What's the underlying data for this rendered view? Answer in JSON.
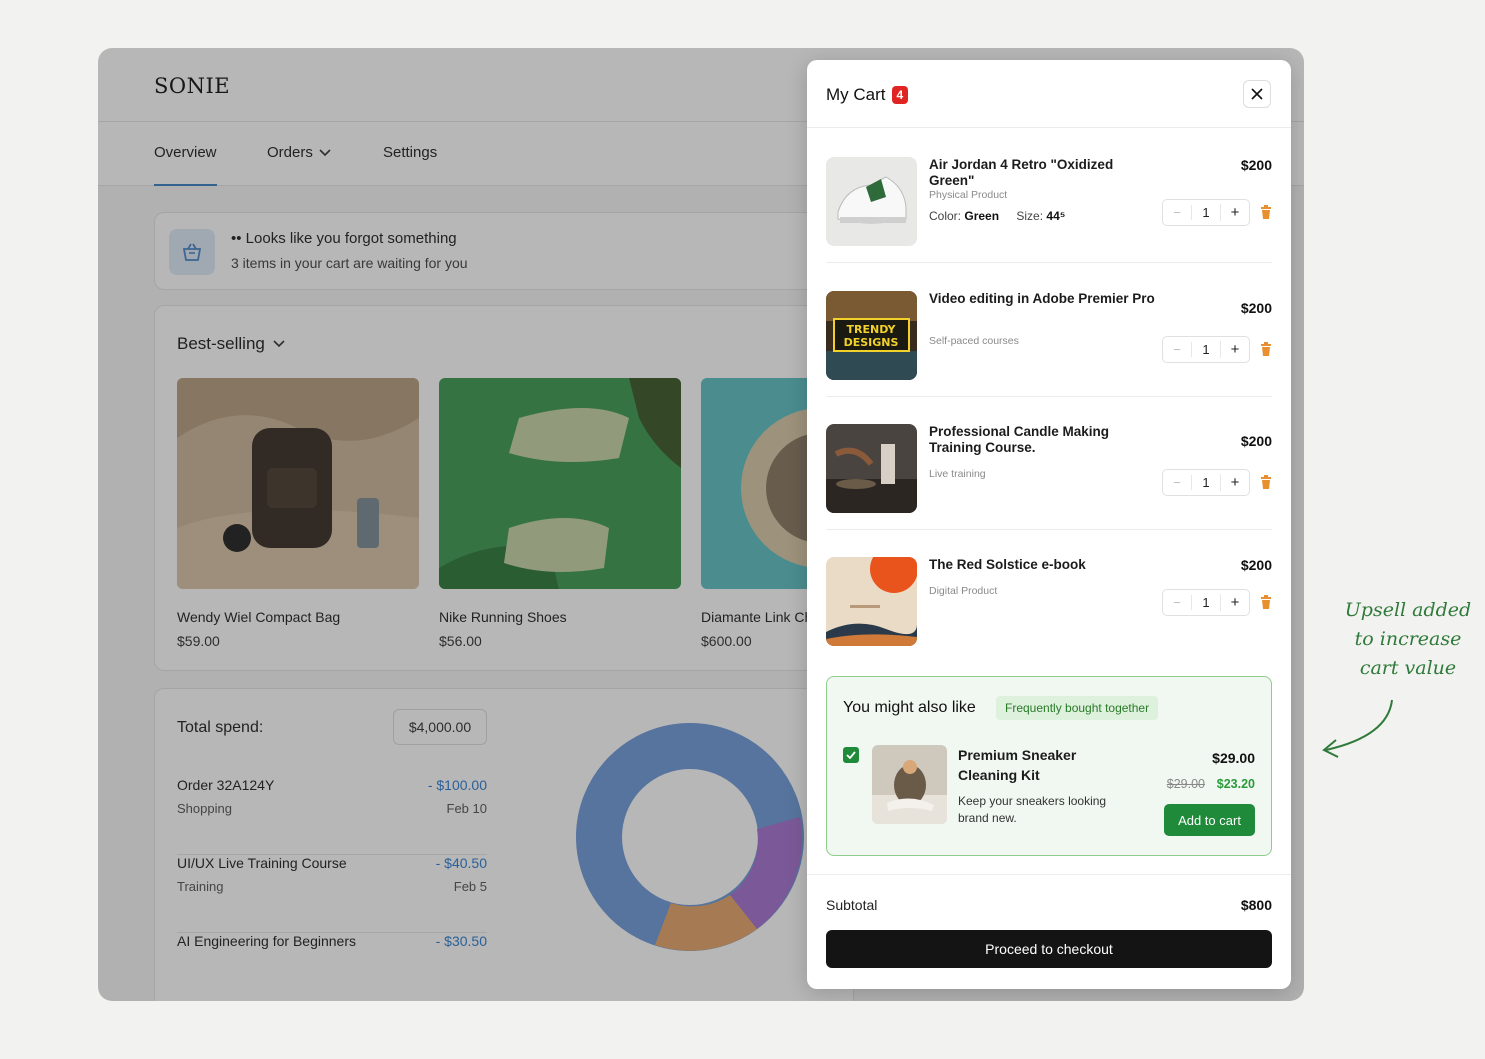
{
  "app": {
    "logo": "SONIE"
  },
  "nav": {
    "overview": "Overview",
    "orders": "Orders",
    "settings": "Settings"
  },
  "notice": {
    "title": "•• Looks like you forgot something",
    "subtitle": "3 items in your cart are waiting for you"
  },
  "best_selling": {
    "title": "Best-selling",
    "products": [
      {
        "name": "Wendy Wiel Compact Bag",
        "price": "$59.00"
      },
      {
        "name": "Nike Running Shoes",
        "price": "$56.00"
      },
      {
        "name": "Diamante Link Cha",
        "price": "$600.00"
      }
    ]
  },
  "spend": {
    "label": "Total spend:",
    "total": "$4,000.00",
    "orders": [
      {
        "name": "Order 32A124Y",
        "category": "Shopping",
        "amount": "- $100.00",
        "date": "Feb 10"
      },
      {
        "name": "UI/UX Live Training Course",
        "category": "Training",
        "amount": "- $40.50",
        "date": "Feb 5"
      },
      {
        "name": "AI Engineering for Beginners",
        "category": "",
        "amount": "- $30.50",
        "date": ""
      }
    ],
    "donut_colors": [
      "#6f9bd8",
      "#a673d1",
      "#e6a66b"
    ]
  },
  "cart": {
    "title": "My Cart",
    "count": "4",
    "items": [
      {
        "name": "Air Jordan 4 Retro \"Oxidized Green\"",
        "type": "Physical Product",
        "color_label": "Color:",
        "color": "Green",
        "size_label": "Size:",
        "size": "44⁵",
        "price": "$200",
        "qty": "1"
      },
      {
        "name": "Video editing in Adobe Premier Pro",
        "type": "Self-paced courses",
        "price": "$200",
        "qty": "1",
        "thumb_text": "TRENDY DESIGNS"
      },
      {
        "name": "Professional Candle Making Training Course.",
        "type": "Live training",
        "price": "$200",
        "qty": "1"
      },
      {
        "name": "The Red Solstice e-book",
        "type": "Digital Product",
        "price": "$200",
        "qty": "1"
      }
    ],
    "upsell": {
      "title": "You might also like",
      "tag": "Frequently bought together",
      "name": "Premium Sneaker Cleaning Kit",
      "description": "Keep your sneakers looking brand new.",
      "price": "$29.00",
      "old_price": "$29.00",
      "new_price": "$23.20",
      "button": "Add to cart",
      "checked": true
    },
    "subtotal_label": "Subtotal",
    "subtotal": "$800",
    "checkout": "Proceed to checkout"
  },
  "annotation": {
    "line1": "Upsell added",
    "line2": "to increase",
    "line3": "cart value"
  },
  "colors": {
    "accent": "#1f8a3a",
    "link": "#2f7fd3",
    "badge": "#e02424",
    "checkout": "#141414"
  }
}
